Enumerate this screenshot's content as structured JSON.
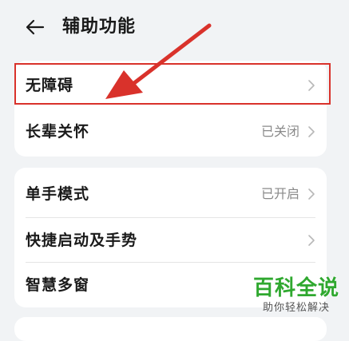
{
  "header": {
    "back_icon": "arrow-left-icon",
    "title": "辅助功能"
  },
  "group1": {
    "items": [
      {
        "label": "无障碍",
        "value": "",
        "icon": "chevron-right-icon"
      },
      {
        "label": "长辈关怀",
        "value": "已关闭",
        "icon": "chevron-right-icon"
      }
    ]
  },
  "group2": {
    "items": [
      {
        "label": "单手模式",
        "value": "已开启",
        "icon": "chevron-right-icon"
      },
      {
        "label": "快捷启动及手势",
        "value": "",
        "icon": "chevron-right-icon"
      },
      {
        "label": "智慧多窗",
        "value": "",
        "icon": "chevron-right-icon"
      }
    ]
  },
  "annotation": {
    "highlight_color": "#d9322b",
    "arrow_color": "#d9322b"
  },
  "watermark": {
    "main": "百科全说",
    "sub": "助你轻松解决",
    "color": "#2fa82f"
  }
}
